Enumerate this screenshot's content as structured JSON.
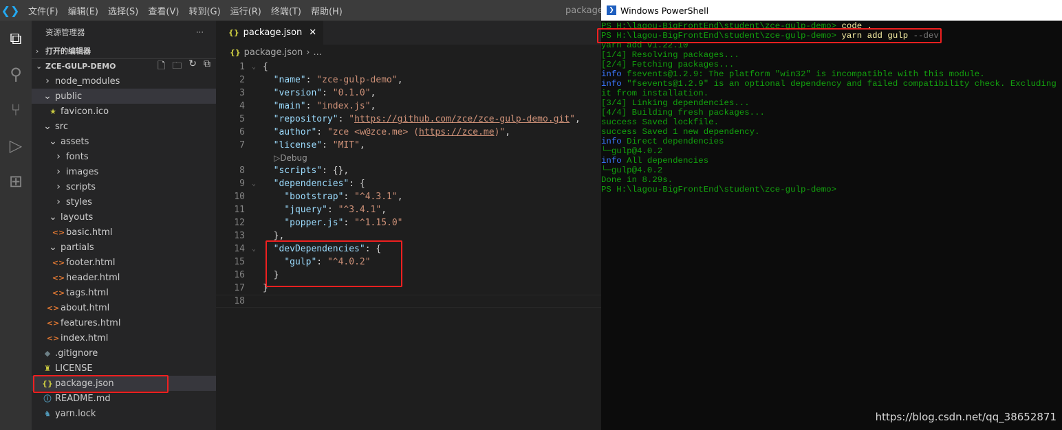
{
  "titlebar": {
    "menus": [
      "文件(F)",
      "编辑(E)",
      "选择(S)",
      "查看(V)",
      "转到(G)",
      "运行(R)",
      "终端(T)",
      "帮助(H)"
    ],
    "window_title": "package.js"
  },
  "activity": [
    "files-icon",
    "search-icon",
    "source-control-icon",
    "run-debug-icon",
    "extensions-icon"
  ],
  "sidebar": {
    "title": "资源管理器",
    "more": "···",
    "open_editors": "打开的编辑器",
    "project": "ZCE-GULP-DEMO",
    "tree": [
      {
        "label": "node_modules",
        "depth": 0,
        "type": "folder",
        "open": false
      },
      {
        "label": "public",
        "depth": 0,
        "type": "folder",
        "open": true,
        "hover": true
      },
      {
        "label": "favicon.ico",
        "depth": 1,
        "type": "favicon"
      },
      {
        "label": "src",
        "depth": 0,
        "type": "folder",
        "open": true
      },
      {
        "label": "assets",
        "depth": 1,
        "type": "folder",
        "open": true
      },
      {
        "label": "fonts",
        "depth": 2,
        "type": "folder",
        "open": false
      },
      {
        "label": "images",
        "depth": 2,
        "type": "folder",
        "open": false
      },
      {
        "label": "scripts",
        "depth": 2,
        "type": "folder",
        "open": false
      },
      {
        "label": "styles",
        "depth": 2,
        "type": "folder",
        "open": false
      },
      {
        "label": "layouts",
        "depth": 1,
        "type": "folder",
        "open": true
      },
      {
        "label": "basic.html",
        "depth": 2,
        "type": "html"
      },
      {
        "label": "partials",
        "depth": 1,
        "type": "folder",
        "open": true
      },
      {
        "label": "footer.html",
        "depth": 2,
        "type": "html"
      },
      {
        "label": "header.html",
        "depth": 2,
        "type": "html"
      },
      {
        "label": "tags.html",
        "depth": 2,
        "type": "html"
      },
      {
        "label": "about.html",
        "depth": 1,
        "type": "html"
      },
      {
        "label": "features.html",
        "depth": 1,
        "type": "html"
      },
      {
        "label": "index.html",
        "depth": 1,
        "type": "html"
      },
      {
        "label": ".gitignore",
        "depth": 0,
        "type": "git"
      },
      {
        "label": "LICENSE",
        "depth": 0,
        "type": "license"
      },
      {
        "label": "package.json",
        "depth": 0,
        "type": "json",
        "selected": true
      },
      {
        "label": "README.md",
        "depth": 0,
        "type": "info"
      },
      {
        "label": "yarn.lock",
        "depth": 0,
        "type": "yarn"
      }
    ]
  },
  "editor": {
    "tab": "package.json",
    "breadcrumb": "package.json",
    "breadcrumb_more": "...",
    "codelens": "Debug",
    "lines": [
      [
        [
          "p",
          "{"
        ]
      ],
      [
        [
          "p",
          "  "
        ],
        [
          "k",
          "\"name\""
        ],
        [
          "p",
          ": "
        ],
        [
          "s",
          "\"zce-gulp-demo\""
        ],
        [
          "p",
          ","
        ]
      ],
      [
        [
          "p",
          "  "
        ],
        [
          "k",
          "\"version\""
        ],
        [
          "p",
          ": "
        ],
        [
          "s",
          "\"0.1.0\""
        ],
        [
          "p",
          ","
        ]
      ],
      [
        [
          "p",
          "  "
        ],
        [
          "k",
          "\"main\""
        ],
        [
          "p",
          ": "
        ],
        [
          "s",
          "\"index.js\""
        ],
        [
          "p",
          ","
        ]
      ],
      [
        [
          "p",
          "  "
        ],
        [
          "k",
          "\"repository\""
        ],
        [
          "p",
          ": "
        ],
        [
          "s",
          "\""
        ],
        [
          "u",
          "https://github.com/zce/zce-gulp-demo.git"
        ],
        [
          "s",
          "\""
        ],
        [
          "p",
          ","
        ]
      ],
      [
        [
          "p",
          "  "
        ],
        [
          "k",
          "\"author\""
        ],
        [
          "p",
          ": "
        ],
        [
          "s",
          "\"zce <w@zce.me> ("
        ],
        [
          "u",
          "https://zce.me"
        ],
        [
          "s",
          ")\""
        ],
        [
          "p",
          ","
        ]
      ],
      [
        [
          "p",
          "  "
        ],
        [
          "k",
          "\"license\""
        ],
        [
          "p",
          ": "
        ],
        [
          "s",
          "\"MIT\""
        ],
        [
          "p",
          ","
        ]
      ],
      [
        [
          "p",
          "  "
        ],
        [
          "k",
          "\"scripts\""
        ],
        [
          "p",
          ": {},"
        ]
      ],
      [
        [
          "p",
          "  "
        ],
        [
          "k",
          "\"dependencies\""
        ],
        [
          "p",
          ": {"
        ]
      ],
      [
        [
          "p",
          "    "
        ],
        [
          "k",
          "\"bootstrap\""
        ],
        [
          "p",
          ": "
        ],
        [
          "s",
          "\"^4.3.1\""
        ],
        [
          "p",
          ","
        ]
      ],
      [
        [
          "p",
          "    "
        ],
        [
          "k",
          "\"jquery\""
        ],
        [
          "p",
          ": "
        ],
        [
          "s",
          "\"^3.4.1\""
        ],
        [
          "p",
          ","
        ]
      ],
      [
        [
          "p",
          "    "
        ],
        [
          "k",
          "\"popper.js\""
        ],
        [
          "p",
          ": "
        ],
        [
          "s",
          "\"^1.15.0\""
        ]
      ],
      [
        [
          "p",
          "  },"
        ]
      ],
      [
        [
          "p",
          "  "
        ],
        [
          "k",
          "\"devDependencies\""
        ],
        [
          "p",
          ": {"
        ]
      ],
      [
        [
          "p",
          "    "
        ],
        [
          "k",
          "\"gulp\""
        ],
        [
          "p",
          ": "
        ],
        [
          "s",
          "\"^4.0.2\""
        ]
      ],
      [
        [
          "p",
          "  }"
        ]
      ],
      [
        [
          "p",
          "}"
        ]
      ],
      [
        [
          "p",
          ""
        ]
      ]
    ]
  },
  "powershell": {
    "title": "Windows PowerShell",
    "prompt": "PS H:\\lagou-BigFrontEnd\\student\\zce-gulp-demo> ",
    "lines": [
      [
        [
          "",
          "PS H:\\lagou-BigFrontEnd\\student\\zce-gulp-demo> "
        ],
        [
          "cmd",
          "code ."
        ]
      ],
      [
        [
          "",
          "PS H:\\lagou-BigFrontEnd\\student\\zce-gulp-demo> "
        ],
        [
          "cmd",
          "yarn add gulp "
        ],
        [
          "dim",
          "--dev"
        ]
      ],
      [
        [
          "",
          "yarn add v1.22.10"
        ]
      ],
      [
        [
          "",
          "[1/4] Resolving packages..."
        ]
      ],
      [
        [
          "",
          "[2/4] Fetching packages..."
        ]
      ],
      [
        [
          "info",
          "info"
        ],
        [
          "",
          " fsevents@1.2.9: The platform \"win32\" is incompatible with this module."
        ]
      ],
      [
        [
          "info",
          "info"
        ],
        [
          "",
          " \"fsevents@1.2.9\" is an optional dependency and failed compatibility check. Excluding it from installation."
        ]
      ],
      [
        [
          "",
          "[3/4] Linking dependencies..."
        ]
      ],
      [
        [
          "",
          "[4/4] Building fresh packages..."
        ]
      ],
      [
        [
          "",
          "success Saved lockfile."
        ]
      ],
      [
        [
          "",
          "success Saved 1 new dependency."
        ]
      ],
      [
        [
          "info",
          "info"
        ],
        [
          "",
          " Direct dependencies"
        ]
      ],
      [
        [
          "",
          "└─gulp@4.0.2"
        ]
      ],
      [
        [
          "info",
          "info"
        ],
        [
          "",
          " All dependencies"
        ]
      ],
      [
        [
          "",
          "└─gulp@4.0.2"
        ]
      ],
      [
        [
          "",
          "Done in 8.29s."
        ]
      ],
      [
        [
          "",
          "PS H:\\lagou-BigFrontEnd\\student\\zce-gulp-demo>"
        ]
      ]
    ]
  },
  "watermark": "https://blog.csdn.net/qq_38652871",
  "colors": {
    "highlight_box": "#f02020",
    "terminal_text": "#13a10e",
    "info": "#3b78ff"
  }
}
